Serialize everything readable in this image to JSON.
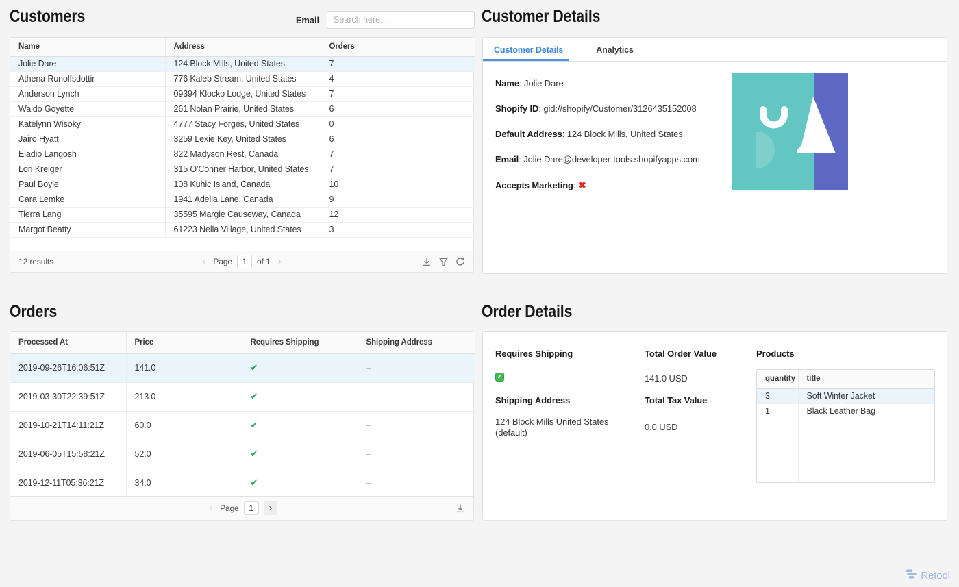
{
  "customers": {
    "title": "Customers",
    "search_label": "Email",
    "search_placeholder": "Search here...",
    "columns": [
      "Name",
      "Address",
      "Orders"
    ],
    "rows": [
      {
        "name": "Jolie Dare",
        "address": "124 Block Mills, United States",
        "orders": "7",
        "selected": true
      },
      {
        "name": "Athena Runolfsdottir",
        "address": "776 Kaleb Stream, United States",
        "orders": "4"
      },
      {
        "name": "Anderson Lynch",
        "address": "09394 Klocko Lodge, United States",
        "orders": "7"
      },
      {
        "name": "Waldo Goyette",
        "address": "261 Nolan Prairie, United States",
        "orders": "6"
      },
      {
        "name": "Katelynn Wisoky",
        "address": "4777 Stacy Forges, United States",
        "orders": "0"
      },
      {
        "name": "Jairo Hyatt",
        "address": "3259 Lexie Key, United States",
        "orders": "6"
      },
      {
        "name": "Eladio Langosh",
        "address": "822 Madyson Rest, Canada",
        "orders": "7"
      },
      {
        "name": "Lori Kreiger",
        "address": "315 O'Conner Harbor, United States",
        "orders": "7"
      },
      {
        "name": "Paul Boyle",
        "address": "108 Kuhic Island, Canada",
        "orders": "10"
      },
      {
        "name": "Cara Lemke",
        "address": "1941 Adella Lane, Canada",
        "orders": "9"
      },
      {
        "name": "Tierra Lang",
        "address": "35595 Margie Causeway, Canada",
        "orders": "12"
      },
      {
        "name": "Margot Beatty",
        "address": "61223 Nella Village, United States",
        "orders": "3"
      }
    ],
    "footer": {
      "results": "12 results",
      "page_label": "Page",
      "page_value": "1",
      "of_label": "of 1",
      "prev_icon": "‹",
      "next_icon": "›"
    }
  },
  "customer_details": {
    "title": "Customer Details",
    "tabs": [
      {
        "label": "Customer Details"
      },
      {
        "label": "Analytics"
      }
    ],
    "fields": [
      {
        "label": "Name",
        "value": "Jolie Dare"
      },
      {
        "label": "Shopify ID",
        "value": "gid://shopify/Customer/3126435152008"
      },
      {
        "label": "Default Address",
        "value": "124 Block Mills, United States"
      },
      {
        "label": "Email",
        "value": "Jolie.Dare@developer-tools.shopifyapps.com"
      },
      {
        "label": "Accepts Marketing",
        "value": "✖"
      }
    ],
    "image_colors": {
      "teal": "#62c6c2",
      "light_teal": "#7fd0cb",
      "purple": "#5c68c3",
      "white": "#ffffff"
    }
  },
  "orders": {
    "title": "Orders",
    "columns": [
      "Processed At",
      "Price",
      "Requires Shipping",
      "Shipping Address"
    ],
    "rows": [
      {
        "processed_at": "2019-09-26T16:06:51Z",
        "price": "141.0",
        "requires_shipping": "✔",
        "shipping_address": "–",
        "selected": true
      },
      {
        "processed_at": "2019-03-30T22:39:51Z",
        "price": "213.0",
        "requires_shipping": "✔",
        "shipping_address": "–"
      },
      {
        "processed_at": "2019-10-21T14:11:21Z",
        "price": "60.0",
        "requires_shipping": "✔",
        "shipping_address": "–"
      },
      {
        "processed_at": "2019-06-05T15:58:21Z",
        "price": "52.0",
        "requires_shipping": "✔",
        "shipping_address": "–"
      },
      {
        "processed_at": "2019-12-11T05:36:21Z",
        "price": "34.0",
        "requires_shipping": "✔",
        "shipping_address": "–"
      }
    ],
    "footer": {
      "page_label": "Page",
      "page_value": "1",
      "prev_icon": "‹",
      "next_icon": "›"
    }
  },
  "order_details": {
    "title": "Order Details",
    "requires_shipping_label": "Requires Shipping",
    "requires_shipping_value": "✓",
    "shipping_address_label": "Shipping Address",
    "shipping_address_value": "124 Block Mills United States (default)",
    "total_order_label": "Total Order Value",
    "total_order_value": "141.0 USD",
    "total_tax_label": "Total Tax Value",
    "total_tax_value": "0.0 USD",
    "products_label": "Products",
    "products_columns": [
      "quantity",
      "title"
    ],
    "products_rows": [
      {
        "quantity": "3",
        "title": "Soft Winter Jacket",
        "selected": true
      },
      {
        "quantity": "1",
        "title": "Black Leather Bag"
      }
    ]
  },
  "brand": {
    "name": "Retool"
  }
}
